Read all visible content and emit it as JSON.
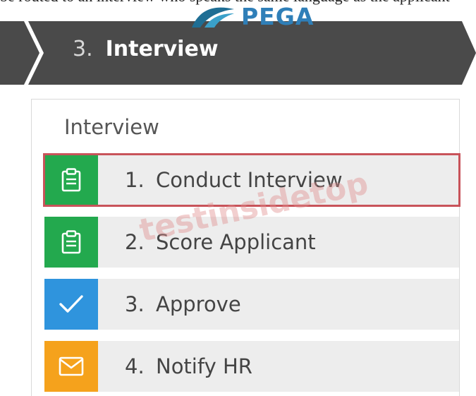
{
  "header_text": "be routed to an interview who speaks the same language as the applicant",
  "logo": {
    "name": "pega-logo",
    "text": "PEGA"
  },
  "stage": {
    "number": "3.",
    "title": "Interview"
  },
  "panel": {
    "title": "Interview"
  },
  "steps": [
    {
      "number": "1.",
      "label": "Conduct Interview",
      "icon": "clipboard-icon",
      "color": "#23a94e",
      "selected": true
    },
    {
      "number": "2.",
      "label": "Score Applicant",
      "icon": "clipboard-icon",
      "color": "#23a94e",
      "selected": false
    },
    {
      "number": "3.",
      "label": "Approve",
      "icon": "checkmark-icon",
      "color": "#2f94dd",
      "selected": false
    },
    {
      "number": "4.",
      "label": "Notify HR",
      "icon": "envelope-icon",
      "color": "#f5a21c",
      "selected": false
    }
  ],
  "watermark": "testinsidetop",
  "colors": {
    "banner": "#4a4a4a",
    "selection_border": "#c8535a",
    "step_bg": "#ededed"
  }
}
